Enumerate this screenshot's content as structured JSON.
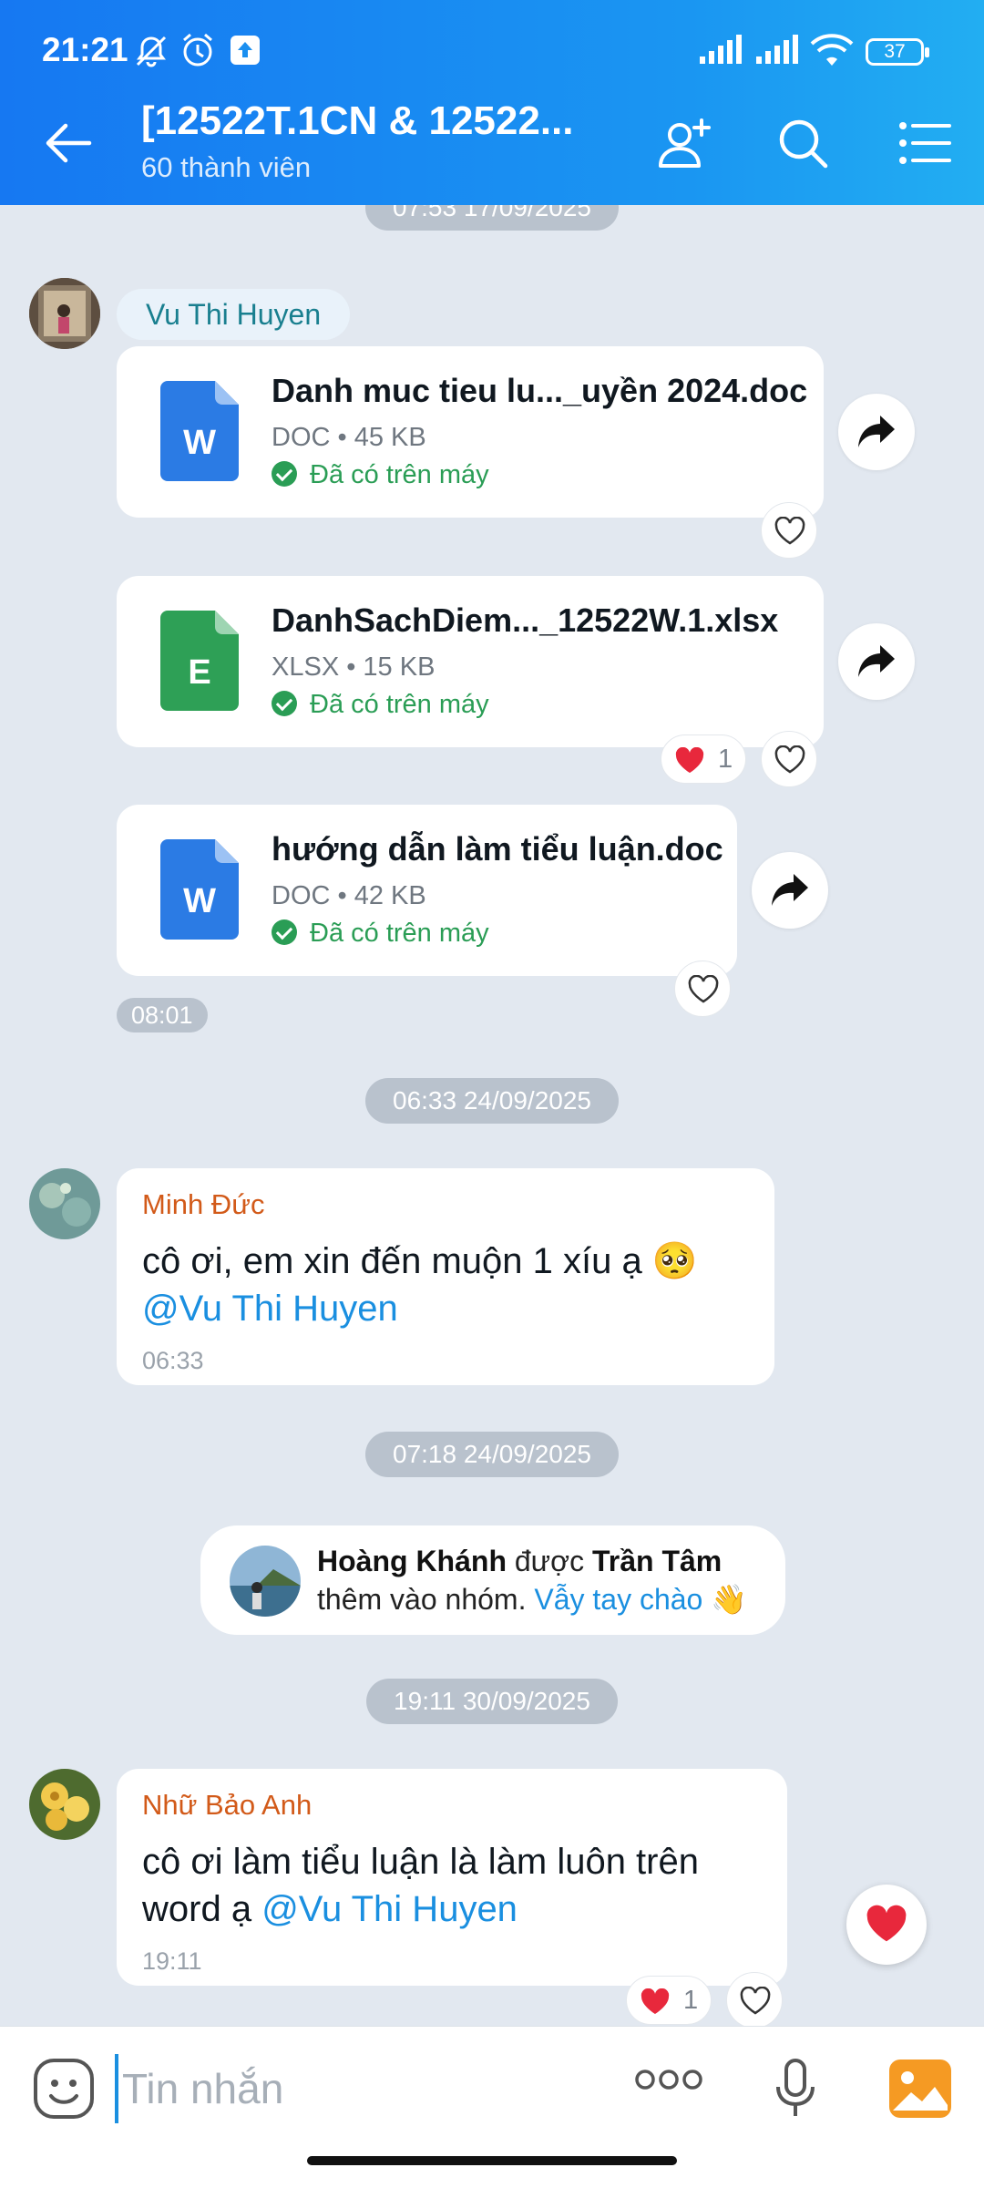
{
  "status_bar": {
    "time": "21:21",
    "battery": "37"
  },
  "header": {
    "title": "[12522T.1CN & 12522...",
    "subtitle": "60 thành viên"
  },
  "date_pills": [
    "07:53 17/09/2025",
    "06:33 24/09/2025",
    "07:18 24/09/2025",
    "19:11 30/09/2025"
  ],
  "sender_vu": "Vu Thi Huyen",
  "files": [
    {
      "name": "Danh muc tieu lu..._uyền 2024.doc",
      "meta": "DOC • 45 KB",
      "status": "Đã có trên máy",
      "type_letter": "W",
      "color": "#2b7be4"
    },
    {
      "name": "DanhSachDiem..._12522W.1.xlsx",
      "meta": "XLSX • 15 KB",
      "status": "Đã có trên máy",
      "type_letter": "E",
      "color": "#2ea056",
      "reaction_count": "1"
    },
    {
      "name": "hướng dẫn làm tiểu luận.doc",
      "meta": "DOC • 42 KB",
      "status": "Đã có trên máy",
      "type_letter": "W",
      "color": "#2b7be4"
    }
  ],
  "file_group_time": "08:01",
  "msg_minh": {
    "sender": "Minh Đức",
    "text": "cô ơi, em xin đến muộn 1 xíu ạ 🥺",
    "mention": "@Vu Thi Huyen",
    "time": "06:33"
  },
  "system_msg": {
    "added": "Hoàng Khánh",
    "by_word": "được",
    "adder": "Trần Tâm",
    "rest": "thêm vào nhóm.",
    "link": "Vẫy tay chào 👋"
  },
  "msg_bao": {
    "sender": "Nhữ Bảo Anh",
    "text_line1": "cô ơi làm tiểu luận là làm luôn trên",
    "text_line2": "word ạ",
    "mention": "@Vu Thi Huyen",
    "time": "19:11",
    "reaction_count": "1"
  },
  "composer": {
    "placeholder": "Tin nhắn"
  },
  "colors": {
    "accent": "#1a8fe0",
    "header_start": "#1678f2",
    "header_end": "#22aef2",
    "heart": "#e8283c"
  }
}
